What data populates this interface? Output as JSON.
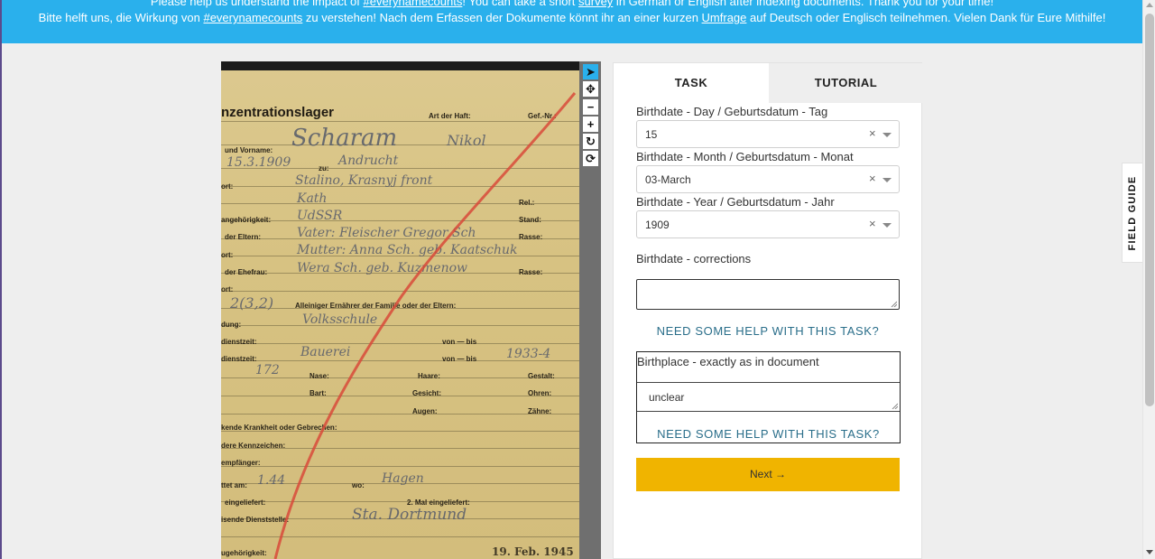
{
  "banner": {
    "line1_pre": "Please help us understand the impact of ",
    "line1_hashtag": "#everynamecounts",
    "line1_mid": "! You can take a short ",
    "line1_link": "survey",
    "line1_post": " in German or English after indexing documents. Thank you for your time!",
    "line2_pre": "Bitte helft uns, die Wirkung von ",
    "line2_hashtag": "#everynamecounts",
    "line2_mid": " zu verstehen! Nach dem Erfassen der Dokumente könnt ihr an einer kurzen ",
    "line2_link": "Umfrage",
    "line2_post": " auf Deutsch oder Englisch teilnehmen. Vielen Dank für Eure Mithilfe!"
  },
  "tools": [
    {
      "name": "pointer-tool",
      "icon": "cursor-icon",
      "glyph": "➤"
    },
    {
      "name": "pan-tool",
      "icon": "move-icon",
      "glyph": "✥"
    },
    {
      "name": "zoom-out-tool",
      "icon": "minus-icon",
      "glyph": "−"
    },
    {
      "name": "zoom-in-tool",
      "icon": "plus-icon",
      "glyph": "+"
    },
    {
      "name": "rotate-tool",
      "icon": "rotate-icon",
      "glyph": "↻"
    },
    {
      "name": "reset-tool",
      "icon": "refresh-icon",
      "glyph": "⟳"
    }
  ],
  "document": {
    "title": "nzentrationslager",
    "labels": {
      "haft": "Art der Haft:",
      "gefnr": "Gef.-Nr.:",
      "vorname": "und Vorname:",
      "zu": "zu:",
      "ort": "ort:",
      "rel": "Rel.:",
      "angehoerigkeit": "angehörigkeit:",
      "stand": "Stand:",
      "eltern": "der Eltern:",
      "rasse": "Rasse:",
      "ort2": "ort:",
      "ehefrau": "der Ehefrau:",
      "rasse2": "Rasse:",
      "ort3": "ort:",
      "ernaehrer": "Alleiniger Ernährer der Familie oder der Eltern:",
      "dung": "dung:",
      "dienstzeit": "dienstzeit:",
      "vonbis": "von — bis",
      "dienstzeit2": "dienstzeit:",
      "vonbis2": "von — bis",
      "nase": "Nase:",
      "haare": "Haare:",
      "gestalt": "Gestalt:",
      "bart": "Bart:",
      "gesicht": "Gesicht:",
      "ohren": "Ohren:",
      "augen": "Augen:",
      "zaehne": "Zähne:",
      "krankheit": "kende Krankheit oder Gebrechen:",
      "kennzeichen": "dere Kennzeichen:",
      "empfaenger": "empfänger:",
      "tetam": "ttet am:",
      "wo": "wo:",
      "eingeliefert": "eingeliefert:",
      "mal": "2. Mal eingeliefert:",
      "dienststelle": "isende Dienststelle:",
      "hoerigkeit": "ugehörigkeit:"
    },
    "handwriting": {
      "name": "Scharam",
      "given": "Nikol",
      "date": "15.3.1909",
      "place": "Andrucht",
      "region": "Stalino, Krasnyj front",
      "kind": "Kath",
      "nation": "UdSSR",
      "father": "Vater: Fleischer Gregor Sch",
      "mother": "Mutter: Anna Sch. geb. Kaatschuk",
      "wife": "Wera Sch. geb. Kuzmenow",
      "children": "2(3,2)",
      "school": "Volksschule",
      "work": "Bauerei",
      "years": "1933-4",
      "height": "172",
      "haftdate": "1.44",
      "haftplace": "Hagen",
      "office": "Sta. Dortmund",
      "stamp": "19. Feb. 1945"
    }
  },
  "tabs": {
    "task": "TASK",
    "tutorial": "TUTORIAL"
  },
  "form": {
    "day_label": "Birthdate - Day / Geburtsdatum - Tag",
    "day_value": "15",
    "month_label": "Birthdate - Month / Geburtsdatum - Monat",
    "month_value": "03-March",
    "year_label": "Birthdate - Year / Geburtsdatum - Jahr",
    "year_value": "1909",
    "clear_glyph": "×",
    "corrections_label": "Birthdate - corrections",
    "corrections_value": "",
    "help_text": "NEED SOME HELP WITH THIS TASK?",
    "birthplace_label": "Birthplace - exactly as in document",
    "birthplace_value": "unclear",
    "help_text_2": "NEED SOME HELP WITH THIS TASK?",
    "next_label": "Next",
    "next_arrow": "→"
  },
  "field_guide": "FIELD GUIDE",
  "colors": {
    "banner": "#2ab0ec",
    "next_button": "#f0b400",
    "help_link": "#2a6e8a",
    "active_tool": "#2ab0ec"
  }
}
